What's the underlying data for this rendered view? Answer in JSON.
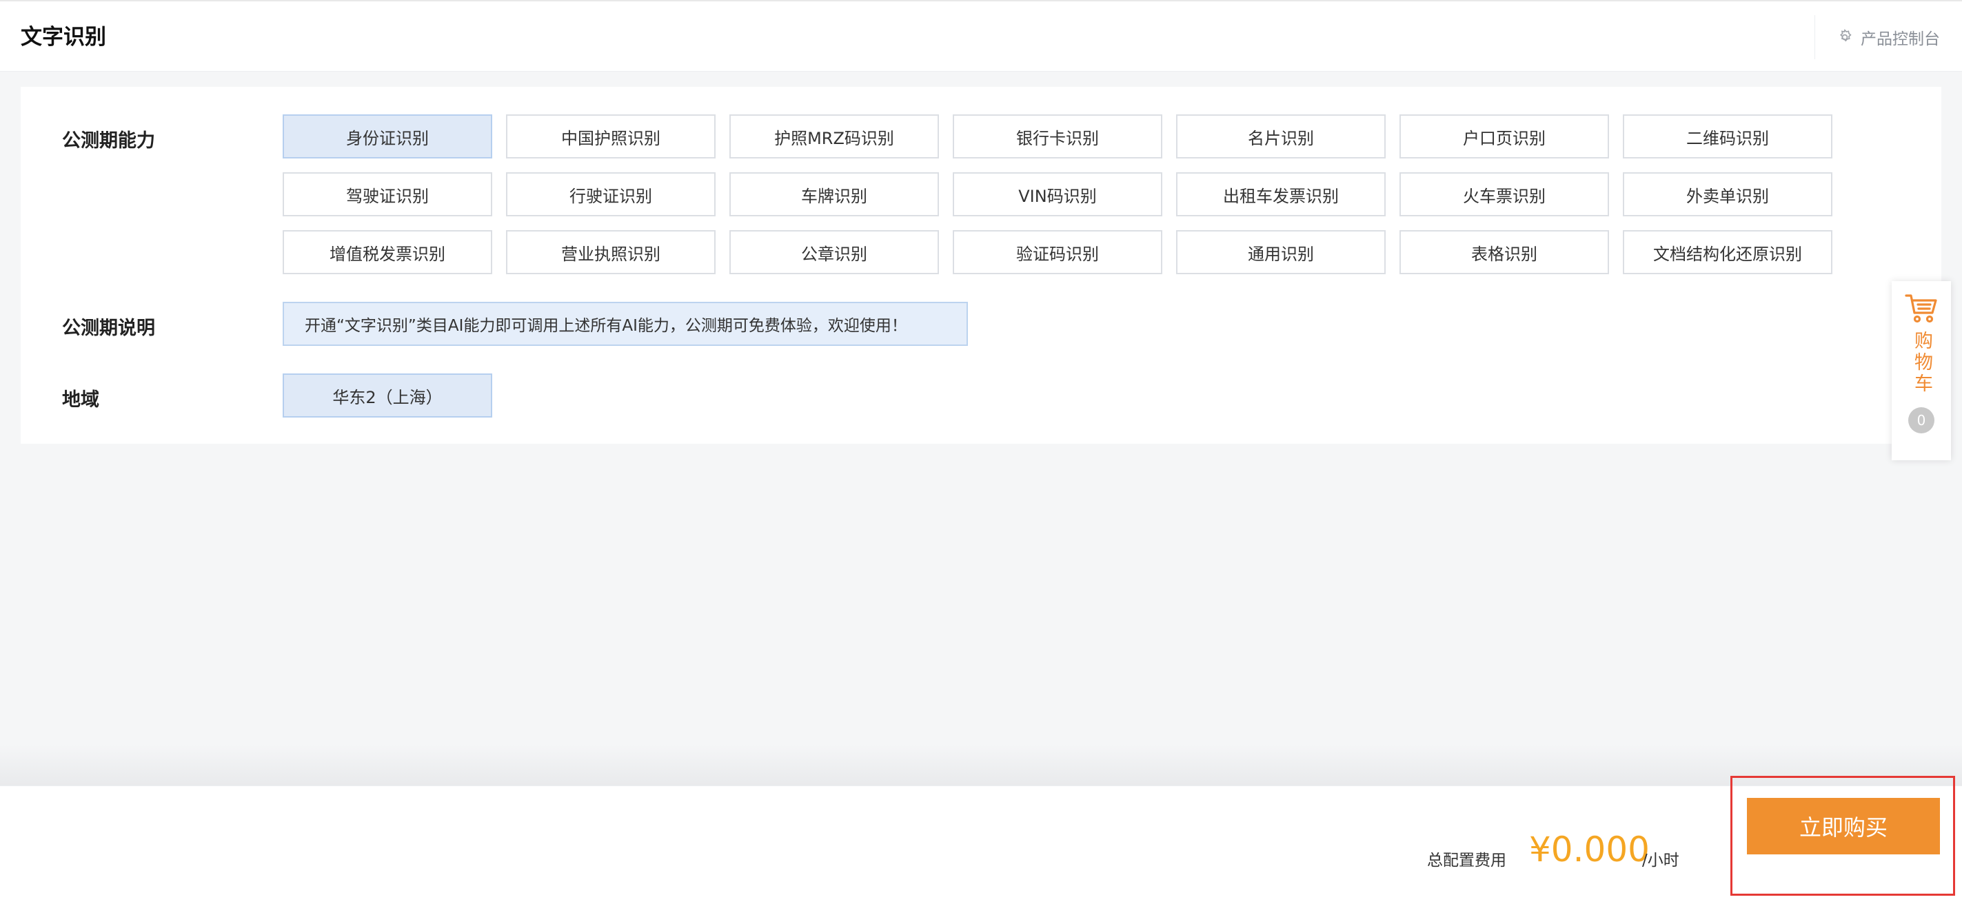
{
  "header": {
    "title": "文字识别",
    "console_label": "产品控制台"
  },
  "config": {
    "capability_label": "公测期能力",
    "capabilities": [
      [
        "身份证识别",
        "中国护照识别",
        "护照MRZ码识别",
        "银行卡识别",
        "名片识别",
        "户口页识别",
        "二维码识别"
      ],
      [
        "驾驶证识别",
        "行驶证识别",
        "车牌识别",
        "VIN码识别",
        "出租车发票识别",
        "火车票识别",
        "外卖单识别"
      ],
      [
        "增值税发票识别",
        "营业执照识别",
        "公章识别",
        "验证码识别",
        "通用识别",
        "表格识别",
        "文档结构化还原识别"
      ]
    ],
    "selected_capability": "身份证识别",
    "description_label": "公测期说明",
    "description_text": "开通“文字识别”类目AI能力即可调用上述所有AI能力，公测期可免费体验，欢迎使用！",
    "region_label": "地域",
    "region_value": "华东2（上海）"
  },
  "cart": {
    "label": "购物车",
    "count": "0"
  },
  "footer": {
    "cost_label": "总配置费用",
    "price": "¥0.000",
    "unit": "/小时",
    "buy_label": "立即购买"
  },
  "colors": {
    "accent_orange": "#f0902f",
    "price_orange": "#f5a623",
    "selected_bg": "#dfe9f7",
    "highlight_red": "#e53935"
  }
}
